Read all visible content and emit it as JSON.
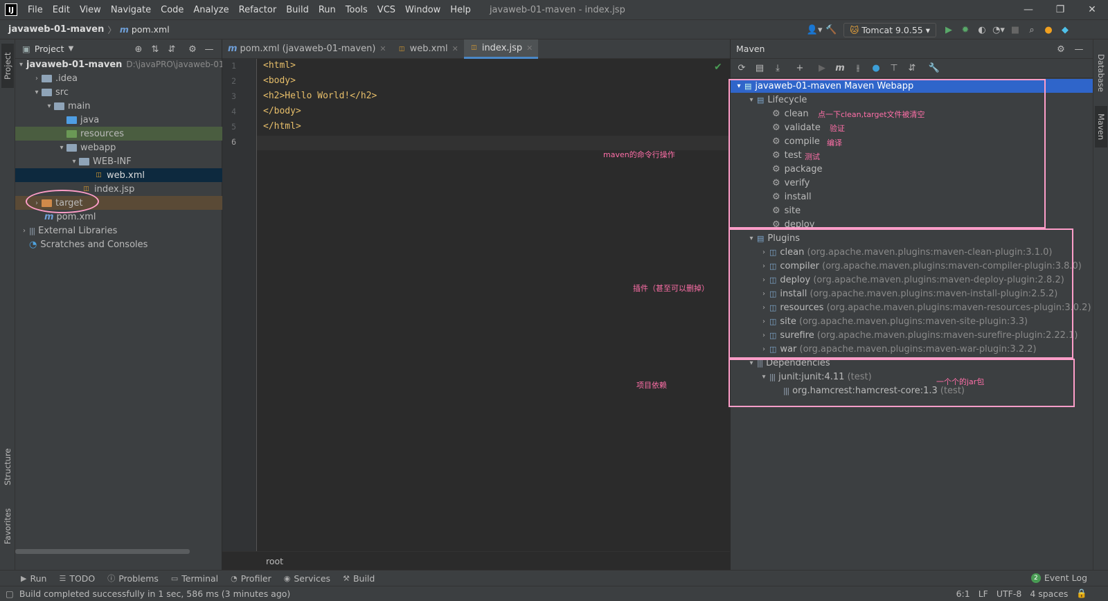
{
  "app": {
    "window_title": "javaweb-01-maven - index.jsp",
    "menu": [
      "File",
      "Edit",
      "View",
      "Navigate",
      "Code",
      "Analyze",
      "Refactor",
      "Build",
      "Run",
      "Tools",
      "VCS",
      "Window",
      "Help"
    ]
  },
  "navbar": {
    "project": "javaweb-01-maven",
    "file": "pom.xml",
    "run_config": "Tomcat 9.0.55"
  },
  "stripes": {
    "project": "Project",
    "structure": "Structure",
    "favorites": "Favorites",
    "database": "Database",
    "maven": "Maven"
  },
  "project_panel": {
    "title": "Project",
    "root_name": "javaweb-01-maven",
    "root_path": "D:\\javaPRO\\javaweb-01",
    "items": [
      ".idea",
      "src",
      "main",
      "java",
      "resources",
      "webapp",
      "WEB-INF",
      "web.xml",
      "index.jsp",
      "target",
      "pom.xml",
      "External Libraries",
      "Scratches and Consoles"
    ]
  },
  "editor": {
    "tabs": [
      "pom.xml (javaweb-01-maven)",
      "web.xml",
      "index.jsp"
    ],
    "lines": [
      "<html>",
      "<body>",
      "<h2>Hello World!</h2>",
      "</body>",
      "</html>",
      ""
    ],
    "line_numbers": [
      "1",
      "2",
      "3",
      "4",
      "5",
      "6"
    ],
    "breadcrumb": "root"
  },
  "maven": {
    "title": "Maven",
    "root": "javaweb-01-maven Maven Webapp",
    "lifecycle_label": "Lifecycle",
    "lifecycle": [
      "clean",
      "validate",
      "compile",
      "test",
      "package",
      "verify",
      "install",
      "site",
      "deploy"
    ],
    "plugins_label": "Plugins",
    "plugins": [
      {
        "name": "clean",
        "coord": "(org.apache.maven.plugins:maven-clean-plugin:3.1.0)"
      },
      {
        "name": "compiler",
        "coord": "(org.apache.maven.plugins:maven-compiler-plugin:3.8.0)"
      },
      {
        "name": "deploy",
        "coord": "(org.apache.maven.plugins:maven-deploy-plugin:2.8.2)"
      },
      {
        "name": "install",
        "coord": "(org.apache.maven.plugins:maven-install-plugin:2.5.2)"
      },
      {
        "name": "resources",
        "coord": "(org.apache.maven.plugins:maven-resources-plugin:3.0.2)"
      },
      {
        "name": "site",
        "coord": "(org.apache.maven.plugins:maven-site-plugin:3.3)"
      },
      {
        "name": "surefire",
        "coord": "(org.apache.maven.plugins:maven-surefire-plugin:2.22.1)"
      },
      {
        "name": "war",
        "coord": "(org.apache.maven.plugins:maven-war-plugin:3.2.2)"
      }
    ],
    "dependencies_label": "Dependencies",
    "dependencies": [
      {
        "name": "junit:junit:4.11",
        "scope": "(test)"
      },
      {
        "name": "org.hamcrest:hamcrest-core:1.3",
        "scope": "(test)"
      }
    ]
  },
  "annotations": {
    "clean": "点一下clean,target文件被清空",
    "validate": "验证",
    "compile": "编译",
    "test": "测试",
    "cmdline": "maven的命令行操作",
    "plugins": "插件（甚至可以删掉）",
    "deps": "项目依赖",
    "jar": "一个个的jar包"
  },
  "bottom": {
    "tools": [
      "Run",
      "TODO",
      "Problems",
      "Terminal",
      "Profiler",
      "Services",
      "Build"
    ],
    "event_log": "Event Log",
    "event_count": "2",
    "status": "Build completed successfully in 1 sec, 586 ms (3 minutes ago)",
    "position": "6:1",
    "line_sep": "LF",
    "encoding": "UTF-8",
    "indent": "4 spaces"
  },
  "colors": {
    "accent": "#2f65ca",
    "annotation": "#ff6fa8",
    "annotation_box": "#ff9ec9"
  }
}
